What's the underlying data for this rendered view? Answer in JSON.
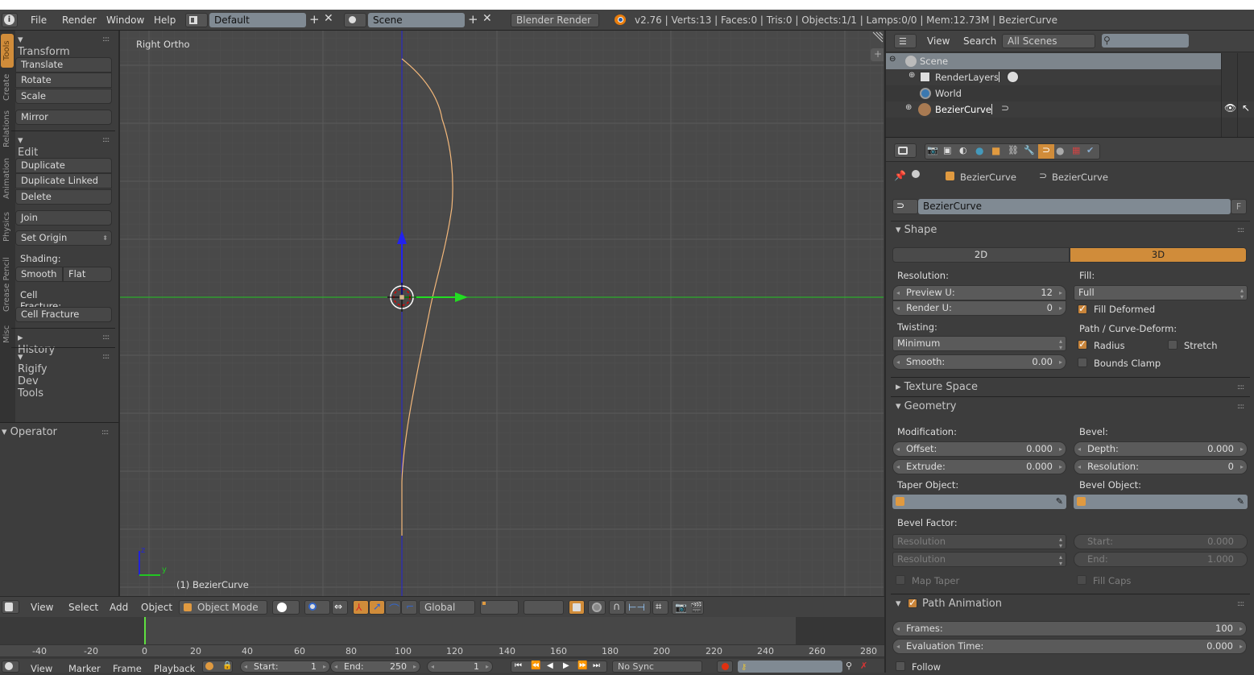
{
  "topbar": {
    "menus": [
      "File",
      "Render",
      "Window",
      "Help"
    ],
    "layout": "Default",
    "scene": "Scene",
    "engine": "Blender Render",
    "status": "v2.76 | Verts:13 | Faces:0 | Tris:0 | Objects:1/1 | Lamps:0/0 | Mem:12.73M | BezierCurve"
  },
  "tool_tabs": [
    "Tools",
    "Create",
    "Relations",
    "Animation",
    "Physics",
    "Grease Pencil",
    "Misc"
  ],
  "toolshelf": {
    "transform_header": "Transform",
    "transform_buttons": [
      "Translate",
      "Rotate",
      "Scale"
    ],
    "mirror": "Mirror",
    "edit_header": "Edit",
    "edit_buttons": [
      "Duplicate",
      "Duplicate Linked",
      "Delete"
    ],
    "join": "Join",
    "set_origin": "Set Origin",
    "shading_label": "Shading:",
    "smooth": "Smooth",
    "flat": "Flat",
    "cell_fracture_label": "Cell Fracture:",
    "cell_fracture": "Cell Fracture",
    "history": "History",
    "rigify": "Rigify Dev Tools",
    "operator": "Operator"
  },
  "viewport": {
    "view_name": "Right Ortho",
    "object_label": "(1) BezierCurve",
    "axis_z": "z",
    "axis_y": "y"
  },
  "view3d_header": {
    "menus": [
      "View",
      "Select",
      "Add",
      "Object"
    ],
    "mode": "Object Mode",
    "orientation": "Global"
  },
  "timeline": {
    "ticks": [
      "-40",
      "-20",
      "0",
      "20",
      "40",
      "60",
      "80",
      "100",
      "120",
      "140",
      "160",
      "180",
      "200",
      "220",
      "240",
      "260",
      "280"
    ],
    "menus": [
      "View",
      "Marker",
      "Frame",
      "Playback"
    ],
    "start_label": "Start:",
    "start": "1",
    "end_label": "End:",
    "end": "250",
    "current_frame": "1",
    "sync": "No Sync"
  },
  "outliner": {
    "menus": [
      "View",
      "Search"
    ],
    "filter": "All Scenes",
    "search_placeholder": "",
    "items": [
      "Scene",
      "RenderLayers",
      "World",
      "BezierCurve"
    ]
  },
  "properties": {
    "breadcrumb_object": "BezierCurve",
    "breadcrumb_data": "BezierCurve",
    "datablock_name": "BezierCurve",
    "fake_user": "F",
    "shape": {
      "header": "Shape",
      "mode_2d": "2D",
      "mode_3d": "3D",
      "active_mode": "3D",
      "resolution_label": "Resolution:",
      "preview_u_label": "Preview U:",
      "preview_u": "12",
      "render_u_label": "Render U:",
      "render_u": "0",
      "twisting_label": "Twisting:",
      "twisting": "Minimum",
      "smooth_label": "Smooth:",
      "smooth": "0.00",
      "fill_label": "Fill:",
      "fill": "Full",
      "fill_deformed": "Fill Deformed",
      "fill_deformed_checked": true,
      "path_label": "Path / Curve-Deform:",
      "radius": "Radius",
      "radius_checked": true,
      "stretch": "Stretch",
      "stretch_checked": false,
      "bounds_clamp": "Bounds Clamp",
      "bounds_clamp_checked": false
    },
    "texture_space": "Texture Space",
    "geometry": {
      "header": "Geometry",
      "modification_label": "Modification:",
      "offset_label": "Offset:",
      "offset": "0.000",
      "extrude_label": "Extrude:",
      "extrude": "0.000",
      "bevel_label": "Bevel:",
      "depth_label": "Depth:",
      "depth": "0.000",
      "bev_res_label": "Resolution:",
      "bev_res": "0",
      "taper_label": "Taper Object:",
      "bevel_obj_label": "Bevel Object:",
      "bevel_factor_label": "Bevel Factor:",
      "bf_mode1": "Resolution",
      "bf_mode2": "Resolution",
      "start_label": "Start:",
      "start": "0.000",
      "end_label": "End:",
      "end": "1.000",
      "map_taper": "Map Taper",
      "fill_caps": "Fill Caps"
    },
    "path_animation": {
      "header": "Path Animation",
      "enabled": true,
      "frames_label": "Frames:",
      "frames": "100",
      "eval_label": "Evaluation Time:",
      "eval": "0.000",
      "follow": "Follow"
    }
  },
  "colors": {
    "accent": "#d08c3a",
    "curve": "#f2b77a",
    "axis_y": "#22c622",
    "axis_z": "#2222d8"
  }
}
